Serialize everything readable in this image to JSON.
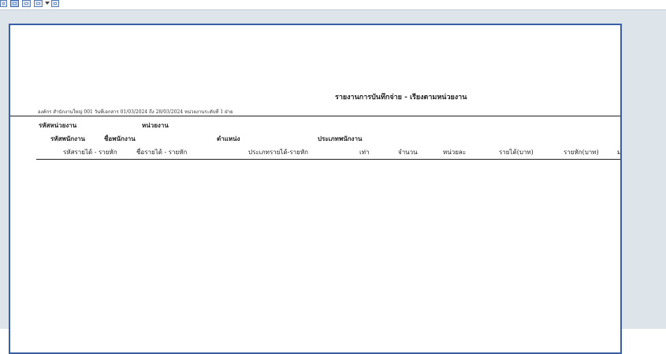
{
  "toolbar": {
    "buttons": [
      {
        "icon": "single-page-icon"
      },
      {
        "icon": "fit-page-icon"
      },
      {
        "icon": "fit-width-icon"
      },
      {
        "icon": "multi-page-icon"
      },
      {
        "icon": "zoom-icon"
      }
    ]
  },
  "report": {
    "title": "รายงานการบันทึกจ่าย - เรียงตามหน่วยงาน",
    "subtitle": "องค์กร สำนักงานใหญ่   001 วันที่เอกสาร 01/03/2024 ถึง 28/03/2024 หน่วยงานระดับที่ 1 ฝ่าย",
    "group_header": {
      "dept_code": "รหัสหน่วยงาน",
      "dept_name": "หน่วยงาน"
    },
    "employee_header": {
      "emp_code": "รหัสพนักงาน",
      "emp_name": "ชื่อพนักงาน",
      "position": "ตำแหน่ง",
      "emp_type": "ประเภทพนักงาน"
    },
    "detail_columns": [
      "รหัสรายได้ - รายหัก",
      "ชื่อรายได้ - รายหัก",
      "ประเภทรายได้-รายหัก",
      "เท่า",
      "จำนวน",
      "หน่วยละ",
      "รายได้(บาท)",
      "รายหัก(บาท)",
      "ม"
    ]
  },
  "colors": {
    "page_border": "#3b5fa6",
    "viewer_bg": "#dde4ea"
  }
}
